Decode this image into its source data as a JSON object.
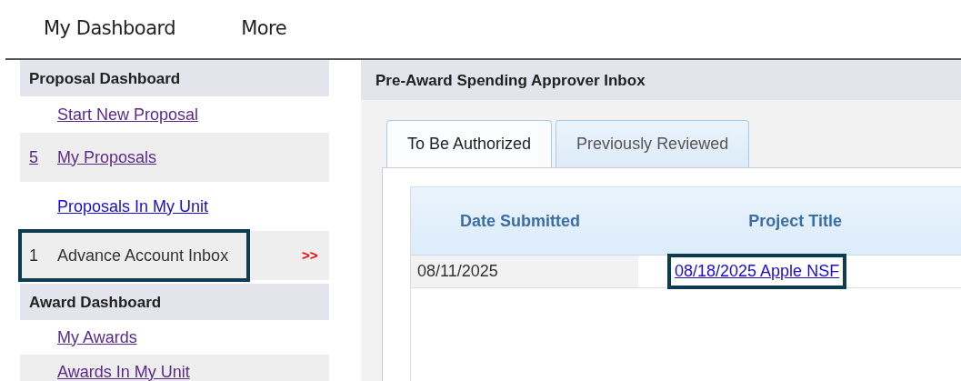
{
  "top_nav": [
    {
      "label": "My Dashboard"
    },
    {
      "label": "More"
    }
  ],
  "sidebar": {
    "sections": [
      {
        "title": "Proposal Dashboard",
        "items": [
          {
            "kind": "link",
            "label": "Start New Proposal",
            "visited": true,
            "highlighted": false
          },
          {
            "kind": "link",
            "count": "5",
            "label": "My Proposals",
            "visited": true,
            "highlighted": false
          },
          {
            "kind": "link",
            "label": "Proposals In My Unit",
            "visited": false,
            "highlighted": false
          },
          {
            "kind": "current",
            "count": "1",
            "label": "Advance Account Inbox",
            "marker": ">>",
            "highlighted": true
          }
        ]
      },
      {
        "title": "Award Dashboard",
        "items": [
          {
            "kind": "link",
            "label": "My Awards",
            "visited": true,
            "highlighted": false
          },
          {
            "kind": "link",
            "label": "Awards In My Unit",
            "visited": true,
            "highlighted": false
          }
        ]
      }
    ]
  },
  "panel": {
    "title": "Pre-Award Spending Approver Inbox",
    "tabs": [
      {
        "label": "To Be Authorized",
        "selected": true
      },
      {
        "label": "Previously Reviewed",
        "selected": false
      }
    ],
    "table": {
      "columns": [
        "Date Submitted",
        "Project Title"
      ],
      "rows": [
        {
          "date": "08/11/2025",
          "title": "08/18/2025 Apple NSF",
          "highlighted": true
        }
      ]
    }
  }
}
